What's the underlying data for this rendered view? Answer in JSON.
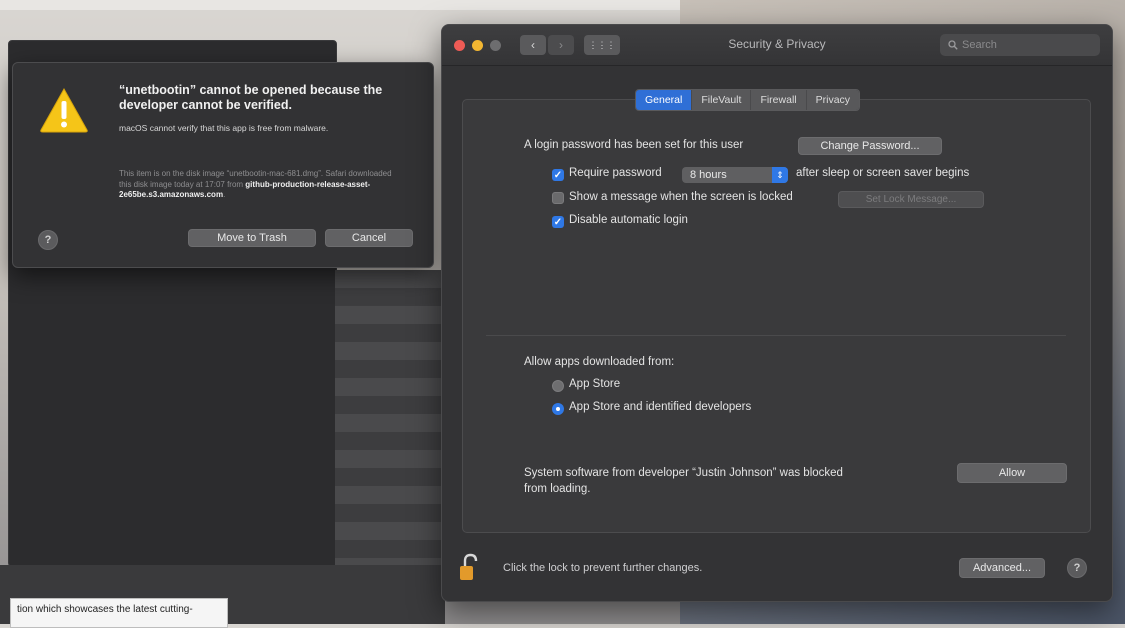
{
  "background_doc": {
    "text": "tion which showcases the latest cutting-"
  },
  "alert": {
    "title": "“unetbootin” cannot be opened because the developer cannot be verified.",
    "message": "macOS cannot verify that this app is free from malware.",
    "info_prefix": "This item is on the disk image “unetbootin-mac-681.dmg”. Safari downloaded this disk image today at 17:07 from ",
    "info_source": "github-production-release-asset-2e65be.s3.amazonaws.com",
    "info_suffix": ".",
    "help": "?",
    "move_to_trash": "Move to Trash",
    "cancel": "Cancel",
    "icon": "warning-triangle-icon"
  },
  "window": {
    "title": "Security & Privacy",
    "search_placeholder": "Search",
    "back": "‹",
    "forward": "›",
    "grid": "⋮⋮⋮"
  },
  "tabs": [
    {
      "label": "General",
      "active": true
    },
    {
      "label": "FileVault",
      "active": false
    },
    {
      "label": "Firewall",
      "active": false
    },
    {
      "label": "Privacy",
      "active": false
    }
  ],
  "general": {
    "login_password_text": "A login password has been set for this user",
    "change_password": "Change Password...",
    "require_password_label": "Require password",
    "require_password_value": "8 hours",
    "require_password_suffix": "after sleep or screen saver begins",
    "show_message_label": "Show a message when the screen is locked",
    "set_lock_message": "Set Lock Message...",
    "disable_auto_login": "Disable automatic login",
    "allow_apps_heading": "Allow apps downloaded from:",
    "app_store": "App Store",
    "app_store_identified": "App Store and identified developers",
    "system_software_text_1": "System software from developer “Justin Johnson” was blocked",
    "system_software_text_2": "from loading.",
    "allow": "Allow"
  },
  "footer": {
    "lock_text": "Click the lock to prevent further changes.",
    "advanced": "Advanced...",
    "help": "?"
  },
  "colors": {
    "accent": "#2f78e6",
    "warning": "#f5c518"
  }
}
